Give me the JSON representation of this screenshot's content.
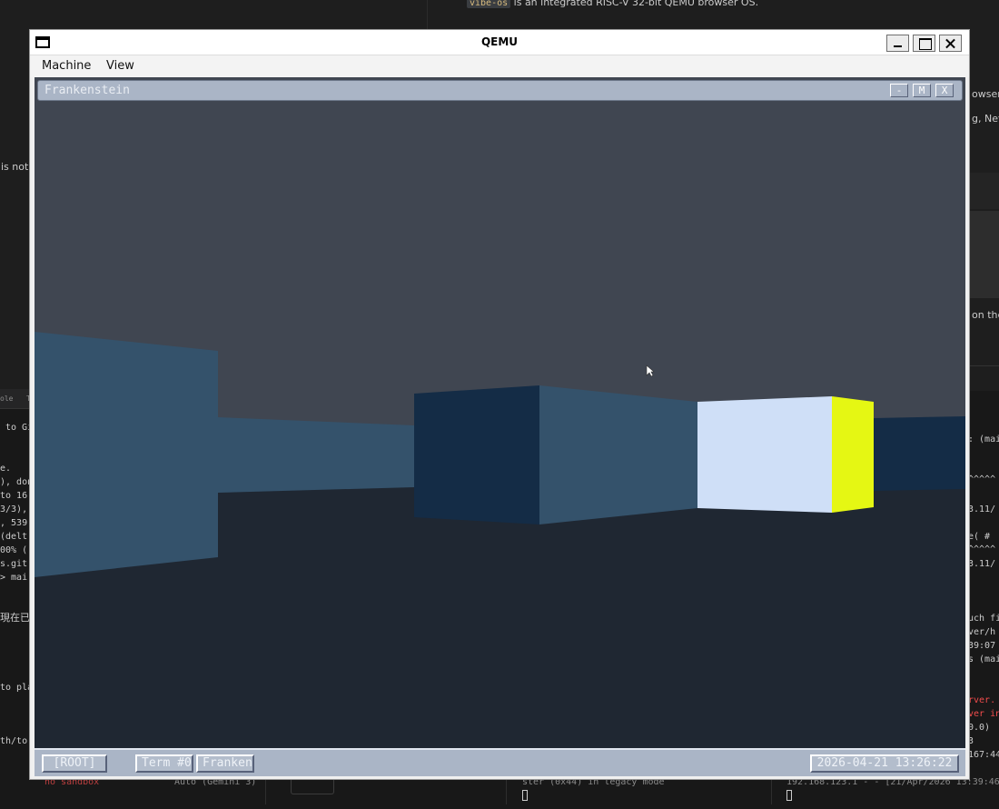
{
  "background": {
    "top_right_line": "is an integrated RISC-V 32-bit QEMU browser OS.",
    "top_right_code": "vibe-os",
    "right_fragments": [
      "owser",
      "g, NetS",
      "on the"
    ],
    "left_fragments": [
      "is not"
    ],
    "left_tabs": [
      "ole",
      "T"
    ],
    "left_terminal": [
      "to Gi",
      "e.",
      "), don",
      "to 16",
      "3/3),",
      ", 539",
      " (delt",
      "00% (",
      "s.git",
      "> mai"
    ],
    "left_cjk": "現在已",
    "left_bottom": [
      "to pla",
      "th/to"
    ],
    "right_terminal": [
      ": (mai",
      "^^^^^",
      "3.11/",
      "e(  #",
      "^^^^^",
      "3.11/",
      "uch fi",
      "ver/h",
      "39:07",
      "s (mai",
      "rver.",
      "ver in",
      "0.0)",
      "3",
      "167:44"
    ],
    "bottom_left": "no sandbox",
    "bottom_model": "Auto (Gemini 3)",
    "bottom_mid": "ster (0x44) in legacy mode",
    "bottom_log": "192.168.123.1 - - [21/Apr/2026 13:39:46"
  },
  "qemu": {
    "title": "QEMU",
    "menu": [
      "Machine",
      "View"
    ]
  },
  "guest": {
    "window_title": "Frankenstein",
    "window_buttons": [
      "-",
      "M",
      "X"
    ],
    "taskbar": {
      "root": "[ROOT]",
      "term": "Term #0",
      "active_app": "Franken",
      "clock": "2026-04-21 13:26:22"
    }
  },
  "colors": {
    "sky": "#404651",
    "floor": "#1f2732",
    "wall_mid": "#34526b",
    "wall_dark": "#142c46",
    "wall_light": "#cfdff7",
    "wall_yellow": "#e5f713",
    "guest_chrome": "#aab5c6"
  }
}
